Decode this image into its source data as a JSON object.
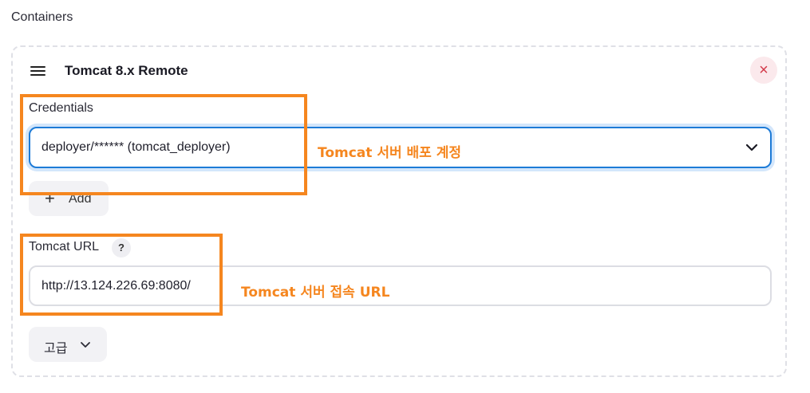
{
  "section": {
    "title": "Containers"
  },
  "container": {
    "title": "Tomcat 8.x Remote",
    "remove_glyph": "×"
  },
  "credentials": {
    "label": "Credentials",
    "selected": "deployer/****** (tomcat_deployer)",
    "add_label": "Add",
    "add_glyph": "+"
  },
  "tomcat_url": {
    "label": "Tomcat URL",
    "help_glyph": "?",
    "value": "http://13.124.226.69:8080/"
  },
  "advanced": {
    "label": "고급"
  },
  "annotations": {
    "credentials_note": "Tomcat 서버 배포 계정",
    "url_note": "Tomcat 서버 접속 URL",
    "highlight_color": "#f5861f"
  },
  "colors": {
    "focus_border": "#1d7bd7",
    "remove_icon": "#d33a4a"
  },
  "icons": {
    "drag": "drag-handle-icon",
    "remove": "close-icon",
    "select": "chevron-down-icon",
    "add": "plus-icon",
    "help": "help-icon",
    "advanced": "chevron-down-icon"
  }
}
